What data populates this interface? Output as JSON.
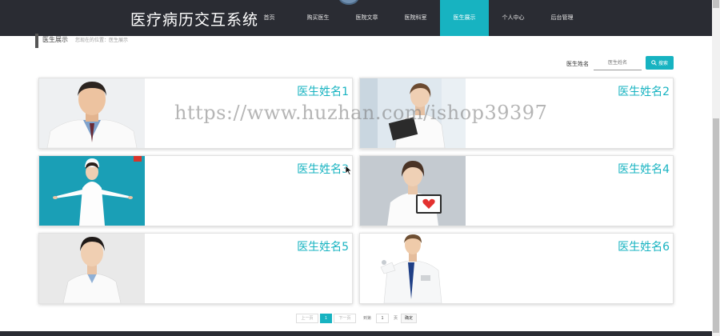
{
  "header": {
    "site_title": "医疗病历交互系统",
    "nav": [
      {
        "label": "首页",
        "active": false
      },
      {
        "label": "购买医生",
        "active": false
      },
      {
        "label": "医院文章",
        "active": false
      },
      {
        "label": "医院科室",
        "active": false
      },
      {
        "label": "医生展示",
        "active": true
      },
      {
        "label": "个人中心",
        "active": false
      },
      {
        "label": "后台管理",
        "active": false
      }
    ]
  },
  "breadcrumb": {
    "title": "医生展示",
    "path": "您现在的位置：医生展示"
  },
  "search": {
    "label": "医生姓名",
    "placeholder": "医生姓名",
    "button_label": "搜索"
  },
  "doctors": [
    {
      "name": "医生姓名1"
    },
    {
      "name": "医生姓名2"
    },
    {
      "name": "医生姓名3"
    },
    {
      "name": "医生姓名4"
    },
    {
      "name": "医生姓名5"
    },
    {
      "name": "医生姓名6"
    }
  ],
  "pagination": {
    "prev_label": "上一页",
    "current_page": "1",
    "next_label": "下一页",
    "goto_prefix": "到第",
    "goto_value": "1",
    "goto_suffix": "页",
    "go_label": "确定"
  },
  "watermark": "https://www.huzhan.com/ishop39397",
  "colors": {
    "accent": "#17b3c1",
    "header_bg": "#2a2c33"
  }
}
